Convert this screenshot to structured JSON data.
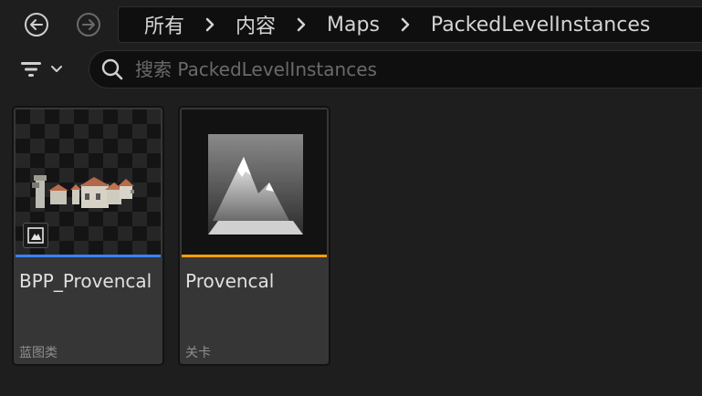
{
  "nav": {
    "back_icon": "arrow-left-circle-icon",
    "forward_icon": "arrow-right-circle-icon"
  },
  "breadcrumb": {
    "items": [
      "所有",
      "内容",
      "Maps",
      "PackedLevelInstances"
    ]
  },
  "search": {
    "placeholder": "搜索 PackedLevelInstances",
    "value": ""
  },
  "assets": [
    {
      "name": "BPP_Provencal",
      "type": "蓝图类",
      "color": "#3b82f6"
    },
    {
      "name": "Provencal",
      "type": "关卡",
      "color": "#f59e0b"
    }
  ]
}
